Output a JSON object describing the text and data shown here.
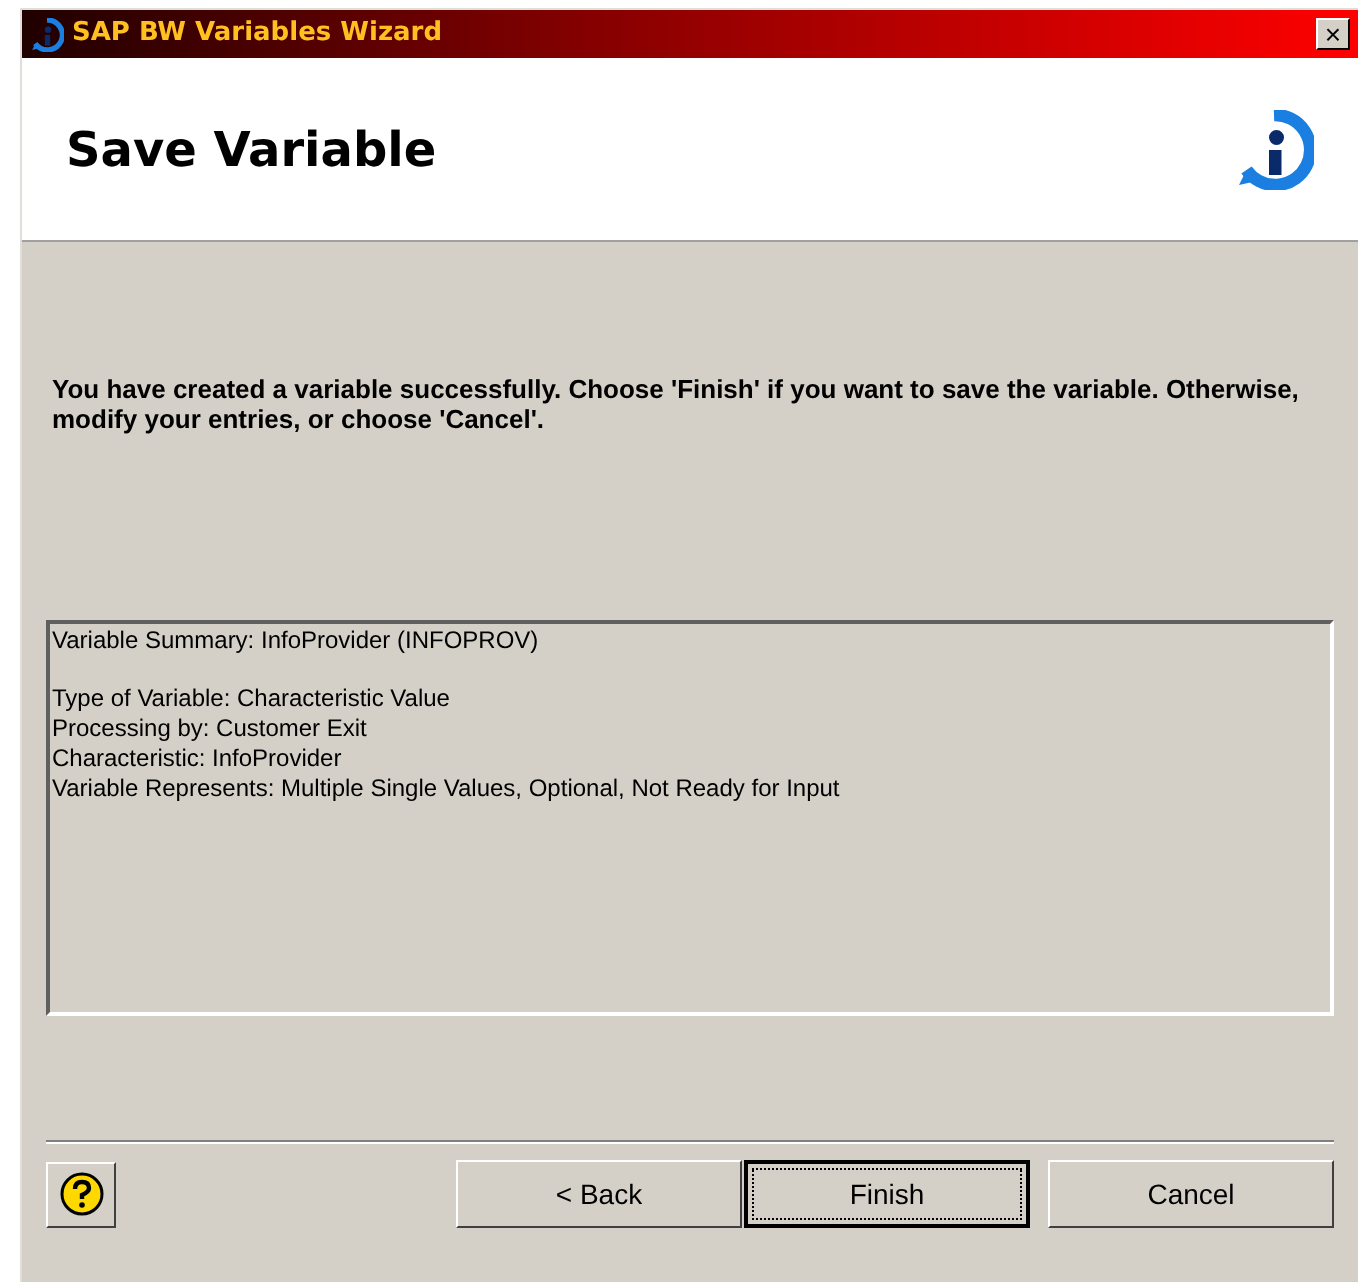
{
  "window": {
    "title": "SAP BW Variables Wizard",
    "close": "×"
  },
  "header": {
    "title": "Save Variable"
  },
  "message": "You have created a variable successfully. Choose 'Finish' if you want to save the variable. Otherwise, modify your entries, or choose 'Cancel'.",
  "summary": {
    "title": "Variable Summary: InfoProvider (INFOPROV)",
    "lines": [
      "Type of Variable: Characteristic Value",
      "Processing by: Customer Exit",
      "Characteristic: InfoProvider",
      "Variable Represents: Multiple Single Values, Optional, Not Ready for Input"
    ]
  },
  "buttons": [
    {
      "label": "< Back",
      "focused": false
    },
    {
      "label": "Finish",
      "focused": true
    },
    {
      "label": "Cancel",
      "focused": false
    }
  ]
}
